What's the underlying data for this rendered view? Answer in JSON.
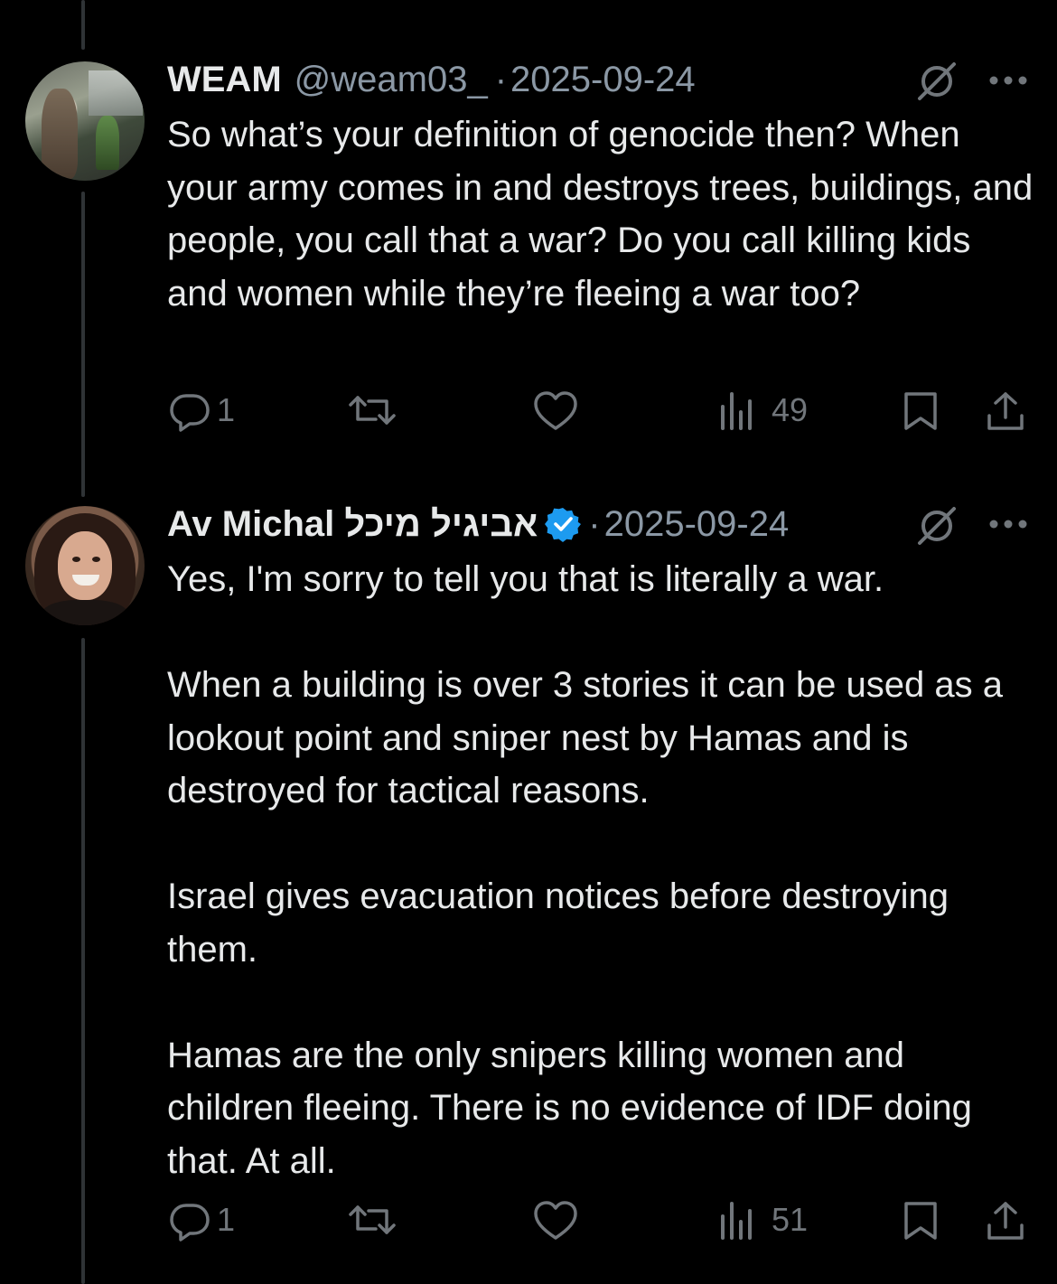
{
  "tweets": [
    {
      "name": "WEAM",
      "handle": "@weam03_",
      "separator": "·",
      "date": "2025-09-24",
      "avatar_icon": "profile-photo",
      "verified": false,
      "text": "So what’s your definition of genocide then? When your army comes in and destroys trees, buildings, and people, you call that a war? Do you call killing kids and women while they’re fleeing a war too?",
      "reply_count": "1",
      "view_count": "49"
    },
    {
      "name": "Av Michal אביגיל מיכל",
      "handle": "",
      "separator": "·",
      "date": "2025-09-24",
      "avatar_icon": "profile-photo",
      "verified": true,
      "text": "Yes, I'm sorry to tell you that is literally a war.\n\nWhen a building is over 3 stories it can be used as a lookout point and sniper nest by Hamas and is destroyed for tactical reasons.\n\nIsrael gives evacuation notices before destroying them.\n\nHamas are the only snipers killing women and children fleeing. There is no evidence of IDF doing that. At all.",
      "reply_count": "1",
      "view_count": "51"
    }
  ],
  "colors": {
    "background": "#000000",
    "text": "#e7e9ea",
    "secondary": "#8b98a5",
    "icon": "#71767b",
    "verified": "#1d9bf0",
    "thread_line": "#2f3336"
  }
}
